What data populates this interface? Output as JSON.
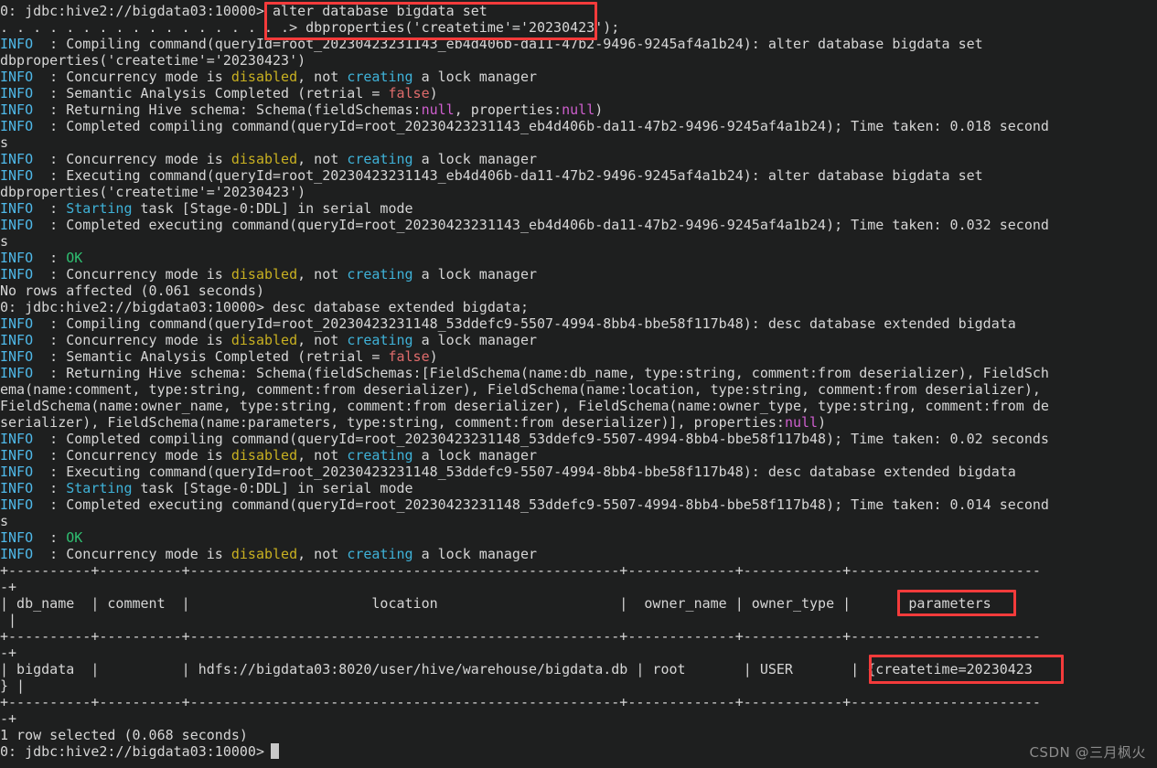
{
  "terminal": {
    "title": "beeline hive2 session",
    "prompt": "0: jdbc:hive2://bigdata03:10000>",
    "continuation_prompt": ". . . . . . . . . . . . . . . . . .>",
    "background_color": "#1e1f1f",
    "foreground_color": "#d6d6d6",
    "colors": {
      "info": "#4fb8e8",
      "ok": "#2fbf71",
      "warn_yellow": "#c8b021",
      "cyan": "#3fb2d8",
      "red": "#e06c6c",
      "magenta": "#cf5fcf",
      "highlight_box": "#f43b3b",
      "plus": "#d8c49a"
    }
  },
  "commands": {
    "alter_line1": "alter database bigdata set",
    "alter_line2": "dbproperties('createtime'='20230423');",
    "desc": "desc database extended bigdata;"
  },
  "query_ids": {
    "alter": "root_20230423231143_eb4d406b-da11-47b2-9496-9245af4a1b24",
    "desc": "root_20230423231148_53ddefc9-5507-4994-8bb4-bbe58f117b48"
  },
  "timings": {
    "alter_compile": "0.018 seconds",
    "alter_execute": "0.032 seconds",
    "alter_rows_affected": "No rows affected (0.061 seconds)",
    "desc_compile": "0.02 seconds",
    "desc_execute": "0.014 seconds",
    "desc_result": "1 row selected (0.068 seconds)"
  },
  "lines": [
    {
      "id": "prompt-alter-1",
      "segs": [
        {
          "t": "0: jdbc:hive2://bigdata03:10000> alter database bigdata set",
          "c": "plain"
        }
      ]
    },
    {
      "id": "prompt-alter-2",
      "segs": [
        {
          "t": ". . . . . . . . . . . . . . . . . .> dbproperties('createtime'='20230423');",
          "c": "plain"
        }
      ]
    },
    {
      "id": "info-compiling-alter",
      "segs": [
        {
          "t": "INFO",
          "c": "info"
        },
        {
          "t": "  : Compiling command(queryId=root_20230423231143_eb4d406b-da11-47b2-9496-9245af4a1b24): alter database bigdata set",
          "c": "plain"
        }
      ]
    },
    {
      "id": "wrap-alter-dbprops-1",
      "segs": [
        {
          "t": "dbproperties('createtime'='20230423')",
          "c": "plain"
        }
      ]
    },
    {
      "id": "info-concurrency-1",
      "segs": [
        {
          "t": "INFO",
          "c": "info"
        },
        {
          "t": "  : Concurrency mode is ",
          "c": "plain"
        },
        {
          "t": "disabled",
          "c": "warn"
        },
        {
          "t": ", not ",
          "c": "plain"
        },
        {
          "t": "creating",
          "c": "cyan"
        },
        {
          "t": " a lock manager",
          "c": "plain"
        }
      ]
    },
    {
      "id": "info-semantic-1",
      "segs": [
        {
          "t": "INFO",
          "c": "info"
        },
        {
          "t": "  : Semantic Analysis Completed (retrial = ",
          "c": "plain"
        },
        {
          "t": "false",
          "c": "red"
        },
        {
          "t": ")",
          "c": "plain"
        }
      ]
    },
    {
      "id": "info-returning-schema-1",
      "segs": [
        {
          "t": "INFO",
          "c": "info"
        },
        {
          "t": "  : Returning Hive schema: Schema(fieldSchemas:",
          "c": "plain"
        },
        {
          "t": "null",
          "c": "mag"
        },
        {
          "t": ", properties:",
          "c": "plain"
        },
        {
          "t": "null",
          "c": "mag"
        },
        {
          "t": ")",
          "c": "plain"
        }
      ]
    },
    {
      "id": "info-completed-compiling-alter",
      "segs": [
        {
          "t": "INFO",
          "c": "info"
        },
        {
          "t": "  : Completed compiling command(queryId=root_20230423231143_eb4d406b-da11-47b2-9496-9245af4a1b24); Time taken: 0.018 second",
          "c": "plain"
        }
      ]
    },
    {
      "id": "wrap-s-1",
      "segs": [
        {
          "t": "s",
          "c": "plain"
        }
      ]
    },
    {
      "id": "info-concurrency-2",
      "segs": [
        {
          "t": "INFO",
          "c": "info"
        },
        {
          "t": "  : Concurrency mode is ",
          "c": "plain"
        },
        {
          "t": "disabled",
          "c": "warn"
        },
        {
          "t": ", not ",
          "c": "plain"
        },
        {
          "t": "creating",
          "c": "cyan"
        },
        {
          "t": " a lock manager",
          "c": "plain"
        }
      ]
    },
    {
      "id": "info-executing-alter",
      "segs": [
        {
          "t": "INFO",
          "c": "info"
        },
        {
          "t": "  : Executing command(queryId=root_20230423231143_eb4d406b-da11-47b2-9496-9245af4a1b24): alter database bigdata set",
          "c": "plain"
        }
      ]
    },
    {
      "id": "wrap-alter-dbprops-2",
      "segs": [
        {
          "t": "dbproperties('createtime'='20230423')",
          "c": "plain"
        }
      ]
    },
    {
      "id": "info-starting-task-1",
      "segs": [
        {
          "t": "INFO",
          "c": "info"
        },
        {
          "t": "  : ",
          "c": "plain"
        },
        {
          "t": "Starting",
          "c": "cyan"
        },
        {
          "t": " task [Stage-0:DDL] in serial mode",
          "c": "plain"
        }
      ]
    },
    {
      "id": "info-completed-executing-alter",
      "segs": [
        {
          "t": "INFO",
          "c": "info"
        },
        {
          "t": "  : Completed executing command(queryId=root_20230423231143_eb4d406b-da11-47b2-9496-9245af4a1b24); Time taken: 0.032 second",
          "c": "plain"
        }
      ]
    },
    {
      "id": "wrap-s-2",
      "segs": [
        {
          "t": "s",
          "c": "plain"
        }
      ]
    },
    {
      "id": "info-ok-1",
      "segs": [
        {
          "t": "INFO",
          "c": "info"
        },
        {
          "t": "  : ",
          "c": "plain"
        },
        {
          "t": "OK",
          "c": "ok"
        }
      ]
    },
    {
      "id": "info-concurrency-3",
      "segs": [
        {
          "t": "INFO",
          "c": "info"
        },
        {
          "t": "  : Concurrency mode is ",
          "c": "plain"
        },
        {
          "t": "disabled",
          "c": "warn"
        },
        {
          "t": ", not ",
          "c": "plain"
        },
        {
          "t": "creating",
          "c": "cyan"
        },
        {
          "t": " a lock manager",
          "c": "plain"
        }
      ]
    },
    {
      "id": "no-rows-affected",
      "segs": [
        {
          "t": "No rows affected (0.061 seconds)",
          "c": "plain"
        }
      ]
    },
    {
      "id": "prompt-desc",
      "segs": [
        {
          "t": "0: jdbc:hive2://bigdata03:10000> desc database extended bigdata;",
          "c": "plain"
        }
      ]
    },
    {
      "id": "info-compiling-desc",
      "segs": [
        {
          "t": "INFO",
          "c": "info"
        },
        {
          "t": "  : Compiling command(queryId=root_20230423231148_53ddefc9-5507-4994-8bb4-bbe58f117b48): desc database extended bigdata",
          "c": "plain"
        }
      ]
    },
    {
      "id": "info-concurrency-4",
      "segs": [
        {
          "t": "INFO",
          "c": "info"
        },
        {
          "t": "  : Concurrency mode is ",
          "c": "plain"
        },
        {
          "t": "disabled",
          "c": "warn"
        },
        {
          "t": ", not ",
          "c": "plain"
        },
        {
          "t": "creating",
          "c": "cyan"
        },
        {
          "t": " a lock manager",
          "c": "plain"
        }
      ]
    },
    {
      "id": "info-semantic-2",
      "segs": [
        {
          "t": "INFO",
          "c": "info"
        },
        {
          "t": "  : Semantic Analysis Completed (retrial = ",
          "c": "plain"
        },
        {
          "t": "false",
          "c": "red"
        },
        {
          "t": ")",
          "c": "plain"
        }
      ]
    },
    {
      "id": "info-returning-schema-2",
      "segs": [
        {
          "t": "INFO",
          "c": "info"
        },
        {
          "t": "  : Returning Hive schema: Schema(fieldSchemas:[FieldSchema(name:db_name, type:string, comment:from deserializer), FieldSch",
          "c": "plain"
        }
      ]
    },
    {
      "id": "wrap-schema-1",
      "segs": [
        {
          "t": "ema(name:comment, type:string, comment:from deserializer), FieldSchema(name:location, type:string, comment:from deserializer),",
          "c": "plain"
        }
      ]
    },
    {
      "id": "wrap-schema-2",
      "segs": [
        {
          "t": "FieldSchema(name:owner_name, type:string, comment:from deserializer), FieldSchema(name:owner_type, type:string, comment:from de",
          "c": "plain"
        }
      ]
    },
    {
      "id": "wrap-schema-3",
      "segs": [
        {
          "t": "serializer), FieldSchema(name:parameters, type:string, comment:from deserializer)], properties:",
          "c": "plain"
        },
        {
          "t": "null",
          "c": "mag"
        },
        {
          "t": ")",
          "c": "plain"
        }
      ]
    },
    {
      "id": "info-completed-compiling-desc",
      "segs": [
        {
          "t": "INFO",
          "c": "info"
        },
        {
          "t": "  : Completed compiling command(queryId=root_20230423231148_53ddefc9-5507-4994-8bb4-bbe58f117b48); Time taken: 0.02 seconds",
          "c": "plain"
        }
      ]
    },
    {
      "id": "info-concurrency-5",
      "segs": [
        {
          "t": "INFO",
          "c": "info"
        },
        {
          "t": "  : Concurrency mode is ",
          "c": "plain"
        },
        {
          "t": "disabled",
          "c": "warn"
        },
        {
          "t": ", not ",
          "c": "plain"
        },
        {
          "t": "creating",
          "c": "cyan"
        },
        {
          "t": " a lock manager",
          "c": "plain"
        }
      ]
    },
    {
      "id": "info-executing-desc",
      "segs": [
        {
          "t": "INFO",
          "c": "info"
        },
        {
          "t": "  : Executing command(queryId=root_20230423231148_53ddefc9-5507-4994-8bb4-bbe58f117b48): desc database extended bigdata",
          "c": "plain"
        }
      ]
    },
    {
      "id": "info-starting-task-2",
      "segs": [
        {
          "t": "INFO",
          "c": "info"
        },
        {
          "t": "  : ",
          "c": "plain"
        },
        {
          "t": "Starting",
          "c": "cyan"
        },
        {
          "t": " task [Stage-0:DDL] in serial mode",
          "c": "plain"
        }
      ]
    },
    {
      "id": "info-completed-executing-desc",
      "segs": [
        {
          "t": "INFO",
          "c": "info"
        },
        {
          "t": "  : Completed executing command(queryId=root_20230423231148_53ddefc9-5507-4994-8bb4-bbe58f117b48); Time taken: 0.014 second",
          "c": "plain"
        }
      ]
    },
    {
      "id": "wrap-s-3",
      "segs": [
        {
          "t": "s",
          "c": "plain"
        }
      ]
    },
    {
      "id": "info-ok-2",
      "segs": [
        {
          "t": "INFO",
          "c": "info"
        },
        {
          "t": "  : ",
          "c": "plain"
        },
        {
          "t": "OK",
          "c": "ok"
        }
      ]
    },
    {
      "id": "info-concurrency-6",
      "segs": [
        {
          "t": "INFO",
          "c": "info"
        },
        {
          "t": "  : Concurrency mode is ",
          "c": "plain"
        },
        {
          "t": "disabled",
          "c": "warn"
        },
        {
          "t": ", not ",
          "c": "plain"
        },
        {
          "t": "creating",
          "c": "cyan"
        },
        {
          "t": " a lock manager",
          "c": "plain"
        }
      ]
    },
    {
      "id": "table-sep-top",
      "segs": [
        {
          "t": "+----------+----------+----------------------------------------------------+-------------+------------+-----------------------",
          "c": "sep"
        }
      ]
    },
    {
      "id": "table-sep-top-wrap",
      "segs": [
        {
          "t": "-+",
          "c": "sep"
        }
      ]
    },
    {
      "id": "table-header",
      "segs": [
        {
          "t": "| db_name  | comment  |                      location                      |  owner_name | owner_type |       parameters      ",
          "c": "plain"
        }
      ]
    },
    {
      "id": "table-header-wrap",
      "segs": [
        {
          "t": " |",
          "c": "plain"
        }
      ]
    },
    {
      "id": "table-sep-mid",
      "segs": [
        {
          "t": "+----------+----------+----------------------------------------------------+-------------+------------+-----------------------",
          "c": "sep"
        }
      ]
    },
    {
      "id": "table-sep-mid-wrap",
      "segs": [
        {
          "t": "-+",
          "c": "sep"
        }
      ]
    },
    {
      "id": "table-row-bigdata",
      "segs": [
        {
          "t": "| bigdata  |          | hdfs://bigdata03:8020/user/hive/warehouse/bigdata.db | root       | USER       | {createtime=20230423",
          "c": "plain"
        }
      ]
    },
    {
      "id": "table-row-wrap",
      "segs": [
        {
          "t": "} |",
          "c": "plain"
        }
      ]
    },
    {
      "id": "table-sep-bottom",
      "segs": [
        {
          "t": "+----------+----------+----------------------------------------------------+-------------+------------+-----------------------",
          "c": "sep"
        }
      ]
    },
    {
      "id": "table-sep-bottom-wrap",
      "segs": [
        {
          "t": "-+",
          "c": "sep"
        }
      ]
    },
    {
      "id": "rows-selected",
      "segs": [
        {
          "t": "1 row selected (0.068 seconds)",
          "c": "plain"
        }
      ]
    },
    {
      "id": "prompt-final",
      "segs": [
        {
          "t": "0: jdbc:hive2://bigdata03:10000> ",
          "c": "plain"
        }
      ]
    }
  ],
  "result_table": {
    "columns": [
      "db_name",
      "comment",
      "location",
      "owner_name",
      "owner_type",
      "parameters"
    ],
    "rows": [
      {
        "db_name": "bigdata",
        "comment": "",
        "location": "hdfs://bigdata03:8020/user/hive/warehouse/bigdata.db",
        "owner_name": "root",
        "owner_type": "USER",
        "parameters": "{createtime=20230423}"
      }
    ]
  },
  "highlights": [
    {
      "id": "box-command",
      "label": "alter database bigdata set dbproperties('createtime'='20230423');"
    },
    {
      "id": "box-parameters",
      "label": "parameters"
    },
    {
      "id": "box-createtime",
      "label": "{createtime=20230423"
    }
  ],
  "watermark": "CSDN @三月枫火"
}
